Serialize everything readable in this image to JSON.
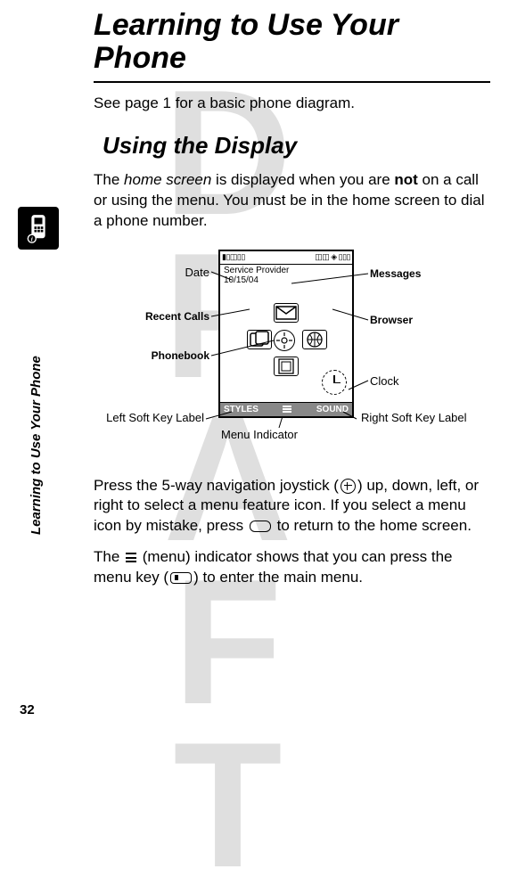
{
  "watermark": "DRAFT",
  "chapter_title": "Learning to Use Your Phone",
  "intro_line": "See page 1 for a basic phone diagram.",
  "section_title": "Using the Display",
  "body_parts": {
    "p1_a": "The ",
    "p1_home_screen": "home screen",
    "p1_b": " is displayed when you are ",
    "p1_not": "not",
    "p1_c": " on a call or using the menu. You must be in the home screen to dial a phone number.",
    "p2_a": "Press the 5-way navigation joystick (",
    "p2_b": ") up, down, left, or right to select a menu feature icon. If you select a menu icon by mistake, press ",
    "p2_c": " to return to the home screen.",
    "p3_a": "The ",
    "p3_b": " (menu) indicator shows that you can press the menu key (",
    "p3_c": ") to enter the main menu."
  },
  "diagram": {
    "status_line_left": "▮▯◫▯▯",
    "status_line_right": "◫◫ ◈ ▯▯▯",
    "provider": "Service Provider",
    "date_value": "10/15/04",
    "left_softkey": "STYLES",
    "right_softkey": "SOUND",
    "callouts": {
      "date": "Date",
      "recent_calls": "Recent Calls",
      "phonebook": "Phonebook",
      "left_soft": "Left Soft Key Label",
      "menu_indicator": "Menu Indicator",
      "right_soft": "Right Soft Key Label",
      "clock": "Clock",
      "browser": "Browser",
      "messages": "Messages"
    }
  },
  "side_label": "Learning to Use Your Phone",
  "page_number": "32"
}
